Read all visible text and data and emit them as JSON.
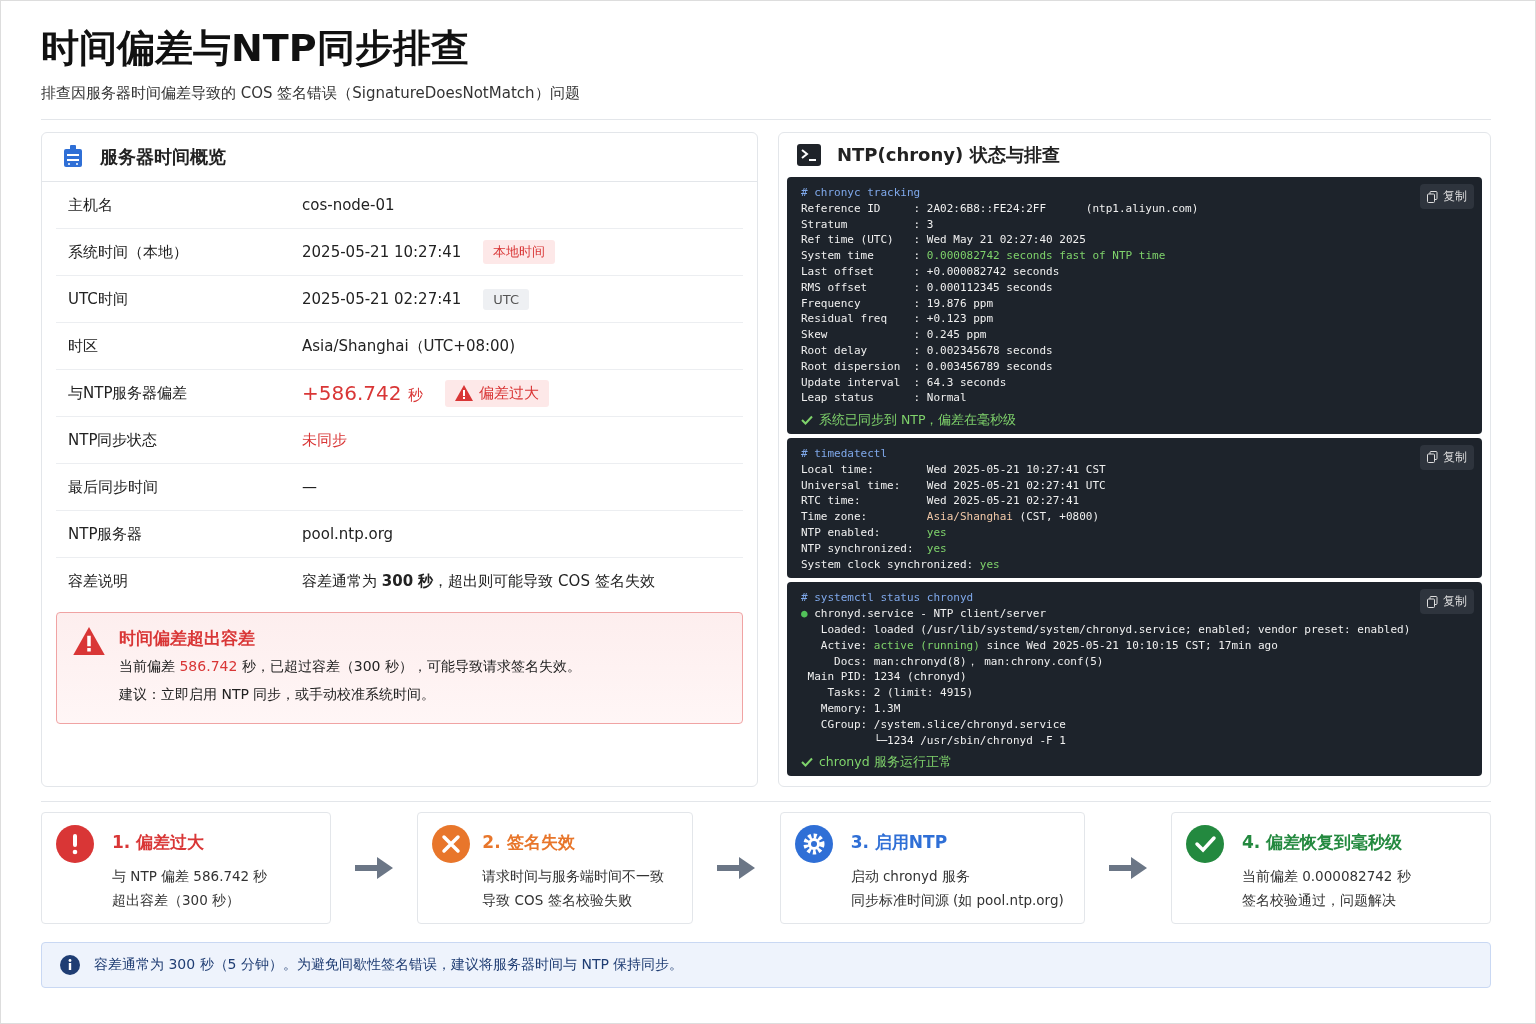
{
  "title": "时间偏差与NTP同步排查",
  "subtitle": "排查因服务器时间偏差导致的 COS 签名错误（SignatureDoesNotMatch）问题",
  "overview": {
    "title": "服务器时间概览",
    "rows": [
      {
        "label": "主机名",
        "value": "cos-node-01",
        "kind": "normal"
      },
      {
        "label": "系统时间（本地）",
        "value": "2025-05-21  10:27:41",
        "kind": "normal",
        "tag": {
          "text": "本地时间",
          "kind": "local"
        }
      },
      {
        "label": "UTC时间",
        "value": "2025-05-21  02:27:41",
        "kind": "normal",
        "tag": {
          "text": "UTC",
          "kind": "neutral"
        }
      },
      {
        "label": "时区",
        "value": "Asia/Shanghai（UTC+08:00)",
        "kind": "normal"
      },
      {
        "label": "与NTP服务器偏差",
        "value": "+586.742",
        "unit": "秒",
        "kind": "big",
        "tag": {
          "text": "偏差过大",
          "kind": "warn"
        }
      },
      {
        "label": "NTP同步状态",
        "value": "未同步",
        "kind": "danger"
      },
      {
        "label": "最后同步时间",
        "value": "—",
        "kind": "normal"
      },
      {
        "label": "NTP服务器",
        "value": "pool.ntp.org",
        "kind": "normal"
      },
      {
        "label": "容差说明",
        "value": "容差通常为 **300 秒**，超出则可能导致 COS 签名失效",
        "kind": "normal"
      }
    ],
    "alert": {
      "title": "时间偏差超出容差",
      "lines": [
        [
          {
            "text": "当前偏差 ",
            "kind": "text"
          },
          {
            "text": "586.742",
            "kind": "danger"
          },
          {
            "text": " 秒，已超过容差（300 秒），可能导致请求签名失效。",
            "kind": "text"
          }
        ],
        [
          {
            "text": "建议：立即启用 NTP 同步，或手动校准系统时间。",
            "kind": "text"
          }
        ]
      ]
    }
  },
  "terminal_panel": {
    "title": "NTP(chrony) 状态与排查",
    "blocks": [
      {
        "command": "# chronyc tracking",
        "copy_label": "复制",
        "lines": [
          [
            {
              "text": "Reference ID     : 2A02:6B8::FE24:2FF      (ntp1.aliyun.com)",
              "kind": "text"
            }
          ],
          [
            {
              "text": "Stratum          : 3",
              "kind": "text"
            }
          ],
          [
            {
              "text": "Ref time (UTC)   : Wed May 21 02:27:40 2025",
              "kind": "text"
            }
          ],
          [
            {
              "text": "System time      : ",
              "kind": "text"
            },
            {
              "text": "0.000082742 seconds fast of NTP time",
              "kind": "ok"
            }
          ],
          [
            {
              "text": "Last offset      : +0.000082742 seconds",
              "kind": "text"
            }
          ],
          [
            {
              "text": "RMS offset       : 0.000112345 seconds",
              "kind": "text"
            }
          ],
          [
            {
              "text": "Frequency        : 19.876 ppm",
              "kind": "text"
            }
          ],
          [
            {
              "text": "Residual freq    : +0.123 ppm",
              "kind": "text"
            }
          ],
          [
            {
              "text": "Skew             : 0.245 ppm",
              "kind": "text"
            }
          ],
          [
            {
              "text": "Root delay       : 0.002345678 seconds",
              "kind": "text"
            }
          ],
          [
            {
              "text": "Root dispersion  : 0.003456789 seconds",
              "kind": "text"
            }
          ],
          [
            {
              "text": "Update interval  : 64.3 seconds",
              "kind": "text"
            }
          ],
          [
            {
              "text": "Leap status      : Normal",
              "kind": "text"
            }
          ]
        ],
        "footer": "系统已同步到 NTP，偏差在毫秒级"
      },
      {
        "command": "# timedatectl",
        "copy_label": "复制",
        "lines": [
          [
            {
              "text": "Local time:        Wed 2025-05-21 10:27:41 CST",
              "kind": "text"
            }
          ],
          [
            {
              "text": "Universal time:    Wed 2025-05-21 02:27:41 UTC",
              "kind": "text"
            }
          ],
          [
            {
              "text": "RTC time:          Wed 2025-05-21 02:27:41",
              "kind": "text"
            }
          ],
          [
            {
              "text": "Time zone:         ",
              "kind": "text"
            },
            {
              "text": "Asia/Shanghai",
              "kind": "accent"
            },
            {
              "text": " (CST, +0800)",
              "kind": "text"
            }
          ],
          [
            {
              "text": "NTP enabled:       ",
              "kind": "text"
            },
            {
              "text": "yes",
              "kind": "ok"
            }
          ],
          [
            {
              "text": "NTP synchronized:  ",
              "kind": "text"
            },
            {
              "text": "yes",
              "kind": "ok"
            }
          ],
          [
            {
              "text": "System clock synchronized: ",
              "kind": "text"
            },
            {
              "text": "yes",
              "kind": "ok"
            }
          ]
        ]
      },
      {
        "command": "# systemctl status chronyd",
        "copy_label": "复制",
        "lines": [
          [
            {
              "text": "●",
              "kind": "dot"
            },
            {
              "text": " chronyd.service - NTP client/server",
              "kind": "text"
            }
          ],
          [
            {
              "text": "   Loaded: loaded (/usr/lib/systemd/system/chronyd.service; enabled; vendor preset: enabled)",
              "kind": "text"
            }
          ],
          [
            {
              "text": "   Active: ",
              "kind": "text"
            },
            {
              "text": "active (running)",
              "kind": "ok"
            },
            {
              "text": " since Wed 2025-05-21 10:10:15 CST; 17min ago",
              "kind": "text"
            }
          ],
          [
            {
              "text": "     Docs: man:chronyd(8)， man:chrony.conf(5)",
              "kind": "text"
            }
          ],
          [
            {
              "text": " Main PID: 1234 (chronyd)",
              "kind": "text"
            }
          ],
          [
            {
              "text": "    Tasks: 2 (limit: 4915)",
              "kind": "text"
            }
          ],
          [
            {
              "text": "   Memory: 1.3M",
              "kind": "text"
            }
          ],
          [
            {
              "text": "   CGroup: /system.slice/chronyd.service",
              "kind": "text"
            }
          ],
          [
            {
              "text": "           └─1234 /usr/sbin/chronyd -F 1",
              "kind": "text"
            }
          ]
        ],
        "footer": "chronyd 服务运行正常"
      }
    ]
  },
  "steps": [
    {
      "kind": "exclamation",
      "color": "#d93636",
      "title": "1. 偏差过大",
      "lines": [
        "与 NTP 偏差 586.742 秒",
        "超出容差（300 秒）"
      ]
    },
    {
      "kind": "cross",
      "color": "#e8762b",
      "title": "2. 签名失效",
      "lines": [
        "请求时间与服务端时间不一致",
        "导致 COS 签名校验失败"
      ]
    },
    {
      "kind": "gear",
      "color": "#2f6fd6",
      "title": "3. 启用NTP",
      "lines": [
        "启动 chronyd 服务",
        "同步标准时间源 (如 pool.ntp.org)"
      ]
    },
    {
      "kind": "check",
      "color": "#23893f",
      "title": "4. 偏差恢复到毫秒级",
      "lines": [
        "当前偏差 0.000082742 秒",
        "签名校验通过，问题解决"
      ]
    }
  ],
  "info": "容差通常为 300 秒（5 分钟）。为避免间歇性签名错误，建议将服务器时间与 NTP 保持同步。"
}
